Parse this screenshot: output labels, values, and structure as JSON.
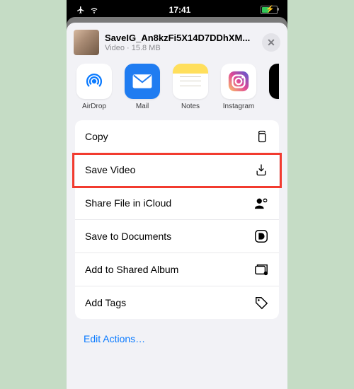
{
  "statusbar": {
    "time": "17:41"
  },
  "file": {
    "name": "SaveIG_An8kzFi5X14D7DDhXM...",
    "kind": "Video",
    "size": "15.8 MB"
  },
  "share_targets": [
    {
      "id": "airdrop",
      "label": "AirDrop"
    },
    {
      "id": "mail",
      "label": "Mail"
    },
    {
      "id": "notes",
      "label": "Notes"
    },
    {
      "id": "instagram",
      "label": "Instagram"
    }
  ],
  "actions": [
    {
      "id": "copy",
      "label": "Copy",
      "icon": "copy-icon"
    },
    {
      "id": "save-video",
      "label": "Save Video",
      "icon": "download-icon",
      "highlighted": true
    },
    {
      "id": "icloud",
      "label": "Share File in iCloud",
      "icon": "person-cloud-icon"
    },
    {
      "id": "save-docs",
      "label": "Save to Documents",
      "icon": "doc-app-icon"
    },
    {
      "id": "shared-album",
      "label": "Add to Shared Album",
      "icon": "album-icon"
    },
    {
      "id": "add-tags",
      "label": "Add Tags",
      "icon": "tag-icon"
    }
  ],
  "footer": {
    "edit": "Edit Actions…"
  }
}
